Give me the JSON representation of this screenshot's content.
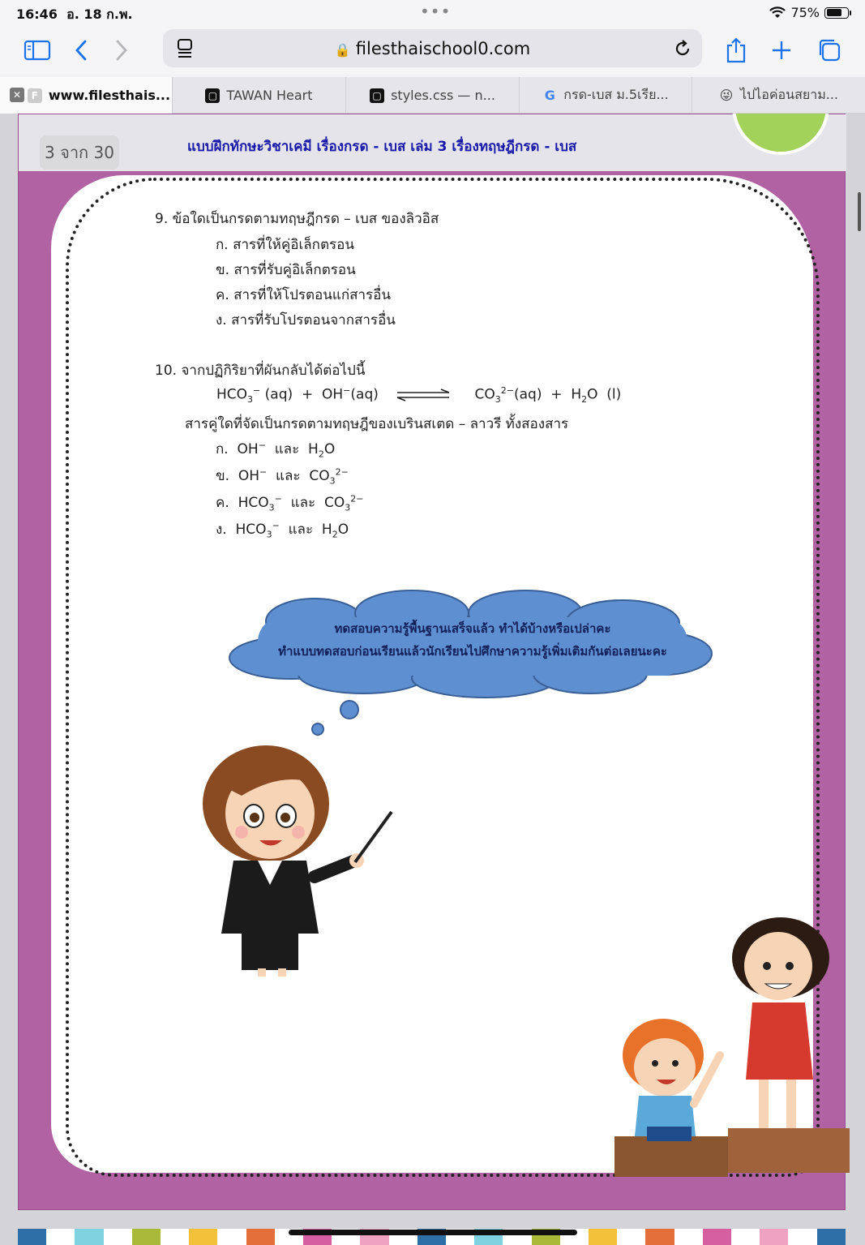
{
  "status": {
    "time": "16:46",
    "date": "อ. 18 ก.พ.",
    "battery": "75%",
    "battery_level": 0.75
  },
  "toolbar": {
    "url": "filesthaischool0.com"
  },
  "tabs": [
    {
      "label": "www.filesthais...",
      "favicon": "F",
      "active": true
    },
    {
      "label": "TAWAN Heart",
      "favicon": "▢",
      "active": false
    },
    {
      "label": "styles.css — n...",
      "favicon": "▢",
      "active": false
    },
    {
      "label": "กรด-เบส ม.5เรีย...",
      "favicon": "G",
      "active": false
    },
    {
      "label": "ไปไอค่อนสยาม...",
      "favicon": "😜",
      "active": false
    }
  ],
  "page": {
    "counter": "3 จาก 30",
    "heading": "แบบฝึกทักษะวิชาเคมี เรื่องกรด - เบส เล่ม 3 เรื่องทฤษฎีกรด - เบส",
    "q9": {
      "question": "9.  ข้อใดเป็นกรดตามทฤษฎีกรด – เบส ของลิวอิส",
      "choices": [
        "ก.  สารที่ให้คู่อิเล็กตรอน",
        "ข.  สารที่รับคู่อิเล็กตรอน",
        "ค.  สารที่ให้โปรตอนแก่สารอื่น",
        "ง.  สารที่รับโปรตอนจากสารอื่น"
      ]
    },
    "q10": {
      "question": "10.  จากปฏิกิริยาที่ผันกลับได้ต่อไปนี้",
      "sub": "สารคู่ใดที่จัดเป็นกรดตามทฤษฎีของเบรินสเตด – ลาวรี  ทั้งสองสาร",
      "choice_prefixes": [
        "ก.",
        "ข.",
        "ค.",
        "ง."
      ],
      "and_word": "และ"
    },
    "cloud": {
      "line1": "ทดสอบความรู้พื้นฐานเสร็จแล้ว  ทำได้บ้างหรือเปล่าคะ",
      "line2": "ทำแบบทดสอบก่อนเรียนแล้วนักเรียนไปศึกษาความรู้เพิ่มเติมกันต่อเลยนะคะ"
    }
  },
  "colors": {
    "accent": "#1a73e8",
    "page_bg": "#b062a3",
    "heading": "#1a1aa8",
    "cloud": "#5e8fd1",
    "strip": [
      "#2f6fa8",
      "#7fd3e0",
      "#a9b93a",
      "#f3c23a",
      "#e56f3a",
      "#d55fa0",
      "#f0a3c0",
      "#e8e8e8"
    ]
  }
}
